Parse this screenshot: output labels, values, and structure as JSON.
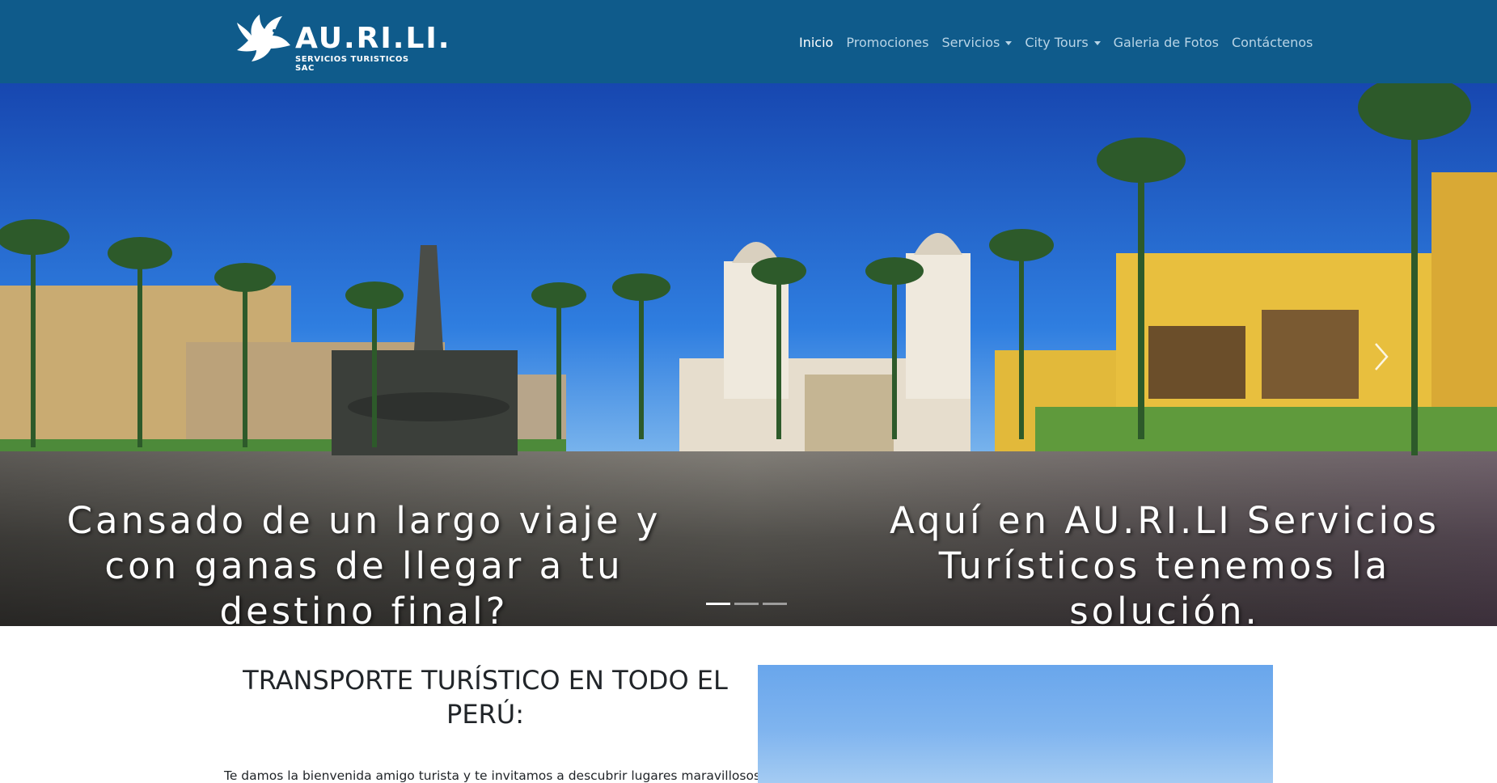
{
  "brand": {
    "name": "AU.RI.LI.",
    "tagline": "SERVICIOS TURISTICOS SAC"
  },
  "nav": {
    "items": [
      {
        "label": "Inicio",
        "active": true,
        "dropdown": false
      },
      {
        "label": "Promociones",
        "active": false,
        "dropdown": false
      },
      {
        "label": "Servicios",
        "active": false,
        "dropdown": true
      },
      {
        "label": "City Tours",
        "active": false,
        "dropdown": true
      },
      {
        "label": "Galeria de Fotos",
        "active": false,
        "dropdown": false
      },
      {
        "label": "Contáctenos",
        "active": false,
        "dropdown": false
      }
    ]
  },
  "hero": {
    "caption_left": "Cansado de un largo viaje y con ganas de llegar a tu destino final?",
    "caption_right": "Aquí en AU.RI.LI Servicios Turísticos tenemos la solución.",
    "slide_count": 3,
    "active_slide": 1
  },
  "content": {
    "title": "TRANSPORTE TURÍSTICO EN TODO EL PERÚ:",
    "intro": "Te damos la bienvenida amigo turista y te invitamos a descubrir lugares maravillosos,"
  },
  "colors": {
    "navbar": "#0f5b8b",
    "nav_link": "#b8d4e6",
    "nav_active": "#ffffff",
    "text": "#212529"
  },
  "icons": {
    "brand": "eagle-logo-icon",
    "dropdown": "caret-down-icon",
    "carousel_next": "chevron-right-icon"
  }
}
